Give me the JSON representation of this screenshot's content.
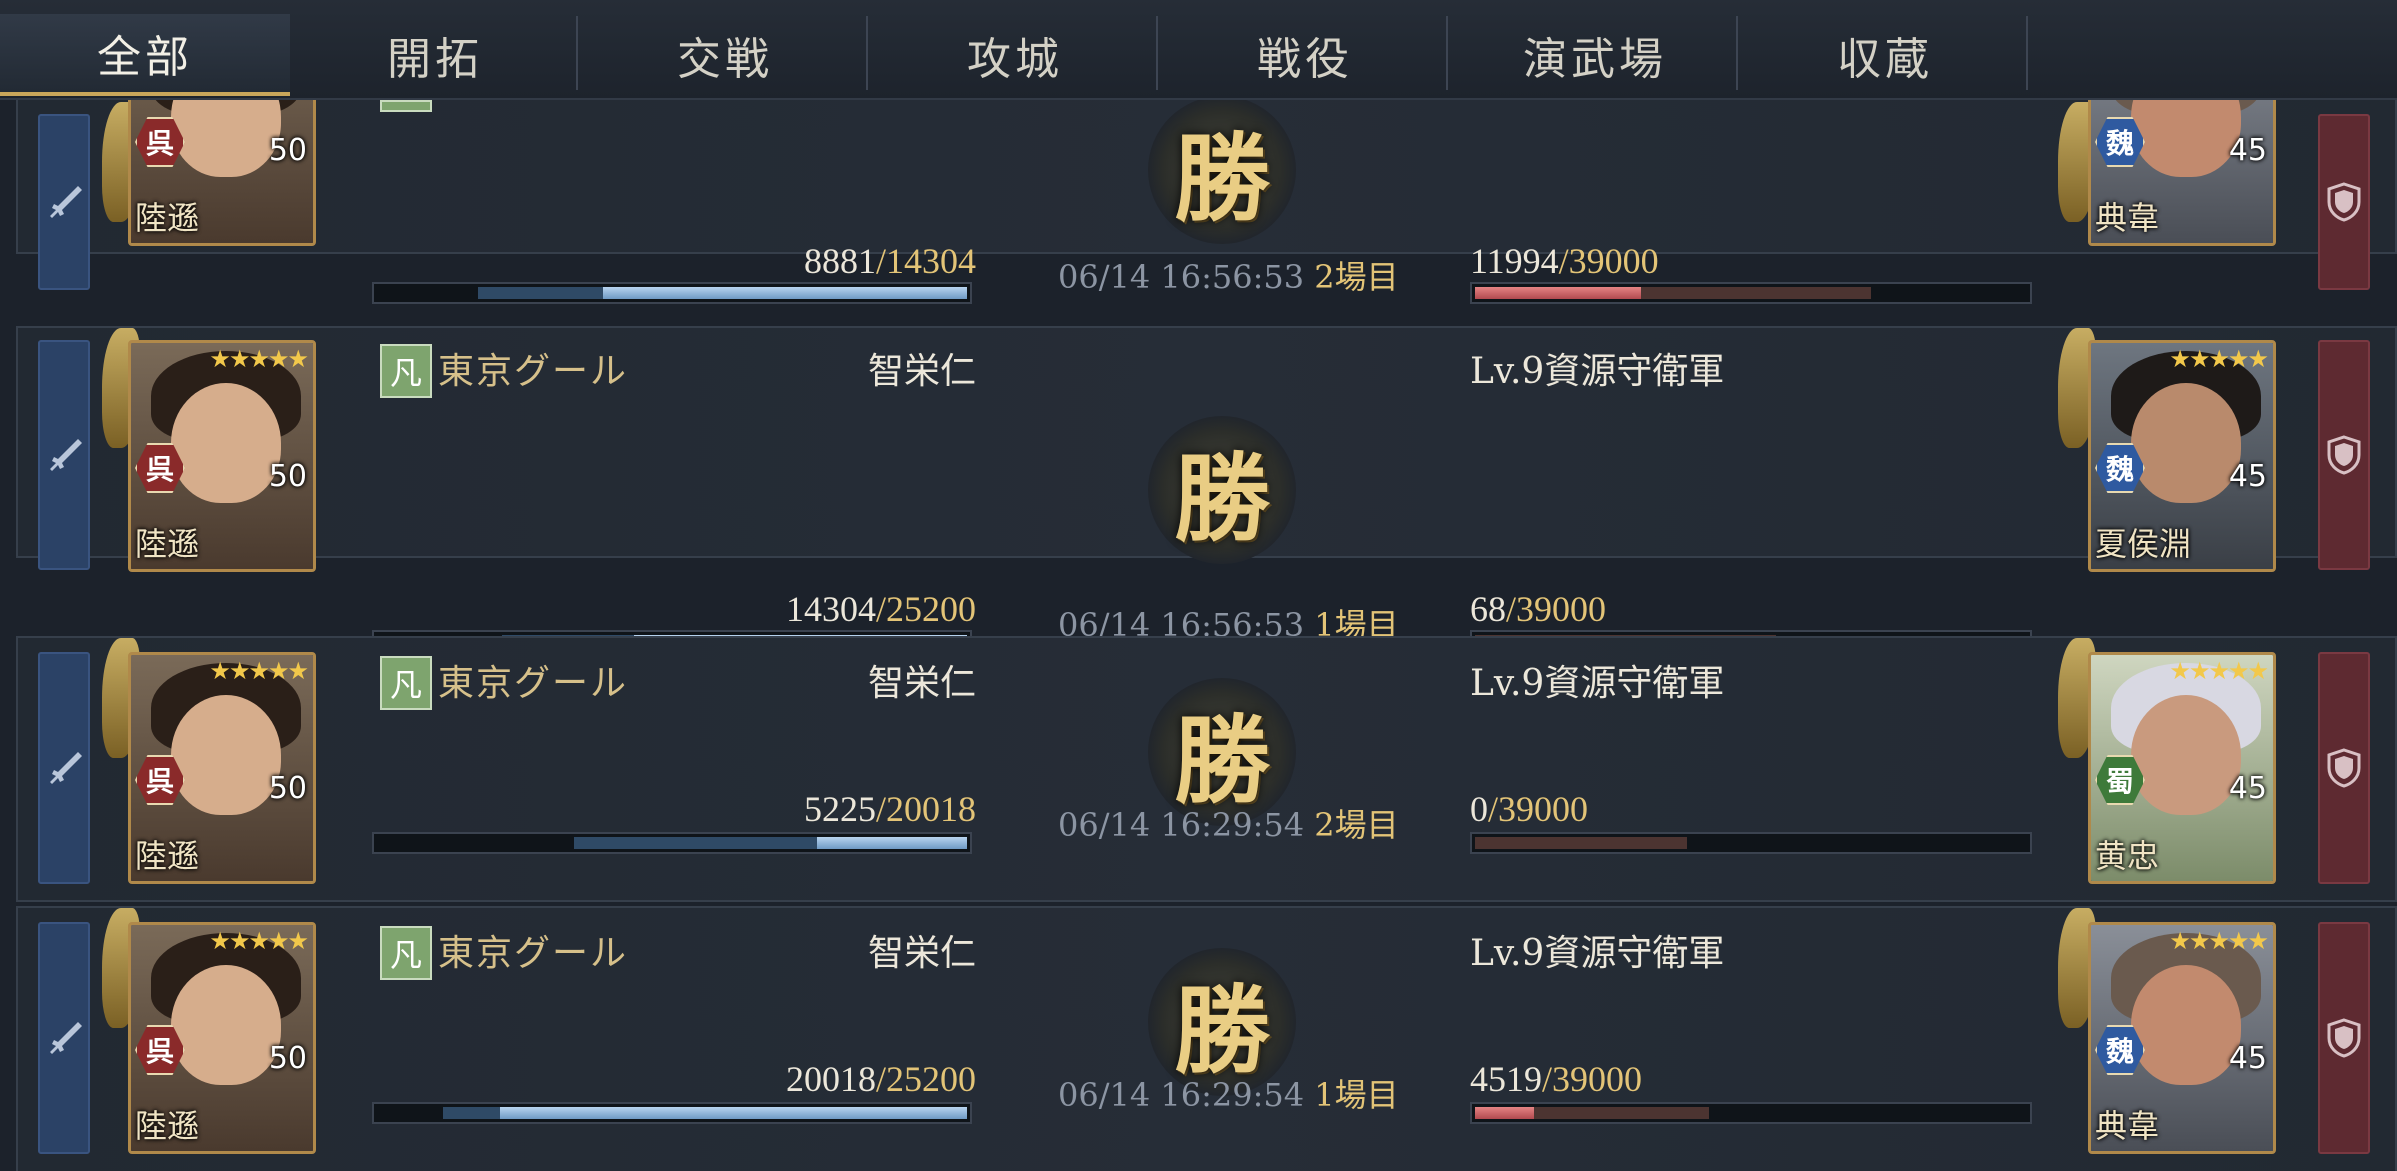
{
  "tabs": [
    {
      "label": "全部",
      "active": true
    },
    {
      "label": "開拓",
      "active": false
    },
    {
      "label": "交戦",
      "active": false
    },
    {
      "label": "攻城",
      "active": false
    },
    {
      "label": "戦役",
      "active": false
    },
    {
      "label": "演武場",
      "active": false
    },
    {
      "label": "収蔵",
      "active": false
    }
  ],
  "colors": {
    "tab_active_underline": "#c9a65a",
    "attacker_side": "#2b4266",
    "defender_side": "#5e2a31",
    "hp_max": "#e3c477",
    "win_glyph": "#e9cd84"
  },
  "battles": [
    {
      "attacker": {
        "name": "陸遜",
        "faction": "呉",
        "level": "50",
        "stars": "",
        "rank": "",
        "guild": "",
        "player": "",
        "hp_cur": "8881",
        "hp_max": "/14304",
        "hp_fraction": 0.621
      },
      "result": "勝",
      "time": "06/14 16:56:53",
      "round": "2場目",
      "defender": {
        "name": "",
        "name_label": "",
        "hp_cur": "11994",
        "hp_max": "/39000",
        "hp_fraction": 0.308,
        "general": "典韋",
        "faction": "魏",
        "level": "45",
        "stars": ""
      }
    },
    {
      "attacker": {
        "name": "陸遜",
        "faction": "呉",
        "level": "50",
        "stars": "★★★★★",
        "rank": "凡",
        "guild": "東京グール",
        "player": "智栄仁",
        "hp_cur": "14304",
        "hp_max": "/25200",
        "hp_fraction": 0.568
      },
      "result": "勝",
      "time": "06/14 16:56:53",
      "round": "1場目",
      "defender": {
        "name_label": "Lv.9資源守衛軍",
        "hp_cur": "68",
        "hp_max": "/39000",
        "hp_fraction": 0.002,
        "general": "夏侯淵",
        "faction": "魏",
        "level": "45",
        "stars": "★★★★★"
      }
    },
    {
      "attacker": {
        "name": "陸遜",
        "faction": "呉",
        "level": "50",
        "stars": "★★★★★",
        "rank": "凡",
        "guild": "東京グール",
        "player": "智栄仁",
        "hp_cur": "5225",
        "hp_max": "/20018",
        "hp_fraction": 0.261
      },
      "result": "勝",
      "time": "06/14 16:29:54",
      "round": "2場目",
      "defender": {
        "name_label": "Lv.9資源守衛軍",
        "hp_cur": "0",
        "hp_max": "/39000",
        "hp_fraction": 0.0,
        "general": "黄忠",
        "faction": "蜀",
        "level": "45",
        "stars": "★★★★★"
      }
    },
    {
      "attacker": {
        "name": "陸遜",
        "faction": "呉",
        "level": "50",
        "stars": "★★★★★",
        "rank": "凡",
        "guild": "東京グール",
        "player": "智栄仁",
        "hp_cur": "20018",
        "hp_max": "/25200",
        "hp_fraction": 0.794
      },
      "result": "勝",
      "time": "06/14 16:29:54",
      "round": "1場目",
      "defender": {
        "name_label": "Lv.9資源守衛軍",
        "hp_cur": "4519",
        "hp_max": "/39000",
        "hp_fraction": 0.116,
        "general": "典韋",
        "faction": "魏",
        "level": "45",
        "stars": "★★★★★"
      }
    }
  ]
}
